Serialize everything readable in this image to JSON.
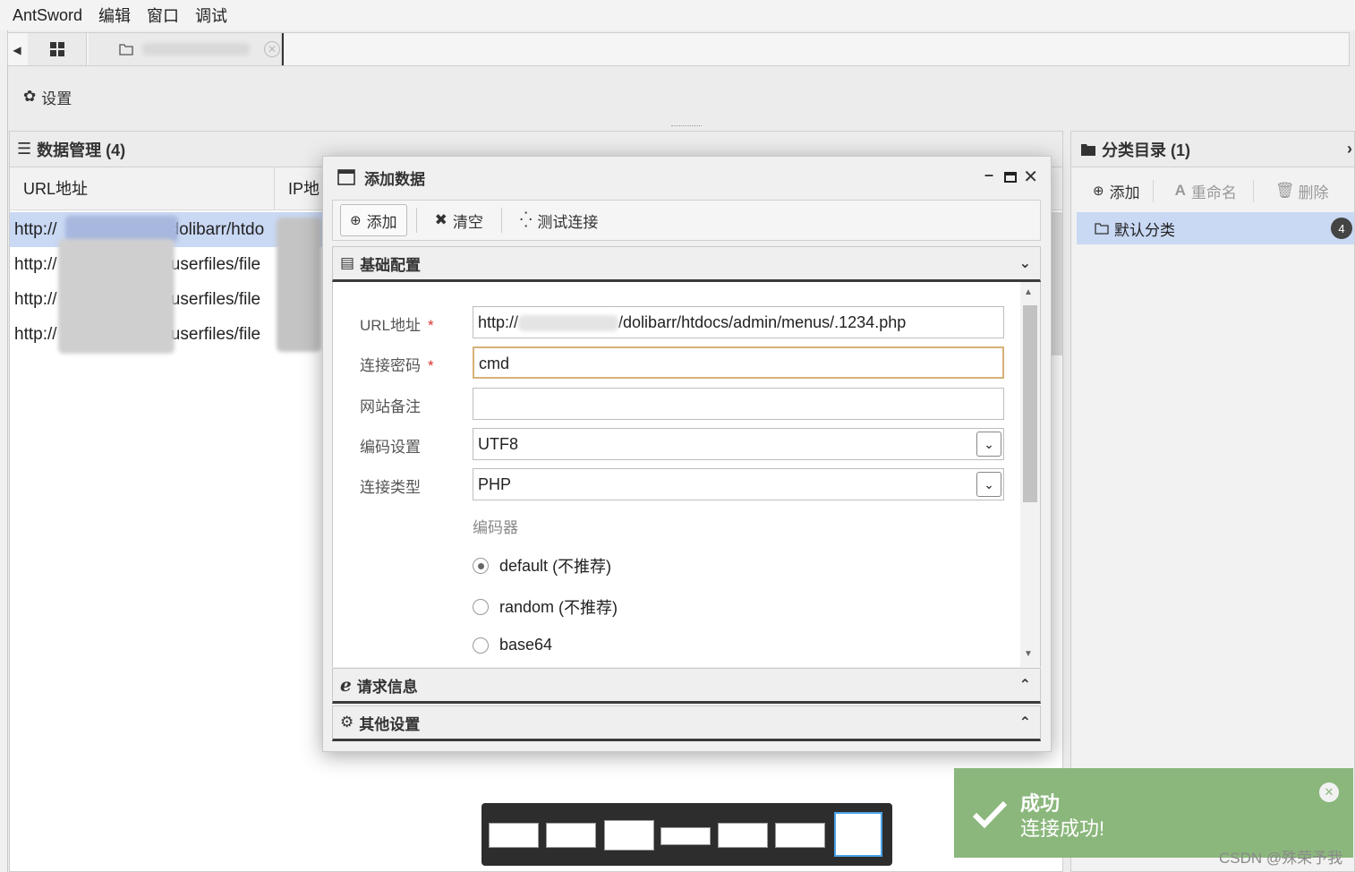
{
  "menubar": {
    "items": [
      "AntSword",
      "编辑",
      "窗口",
      "调试"
    ]
  },
  "settings": {
    "label": "设置"
  },
  "data_panel": {
    "title": "数据管理 (4)",
    "columns": [
      "URL地址",
      "IP地"
    ],
    "rows": [
      {
        "url_start": "http://",
        "url_end": "dolibarr/htdo"
      },
      {
        "url_start": "http://",
        "url_end": "/userfiles/file"
      },
      {
        "url_start": "http://",
        "url_end": "/userfiles/file"
      },
      {
        "url_start": "http://",
        "url_end": "/userfiles/file"
      }
    ]
  },
  "category_panel": {
    "title": "分类目录 (1)",
    "toolbar": {
      "add": "添加",
      "rename": "重命名",
      "delete": "删除"
    },
    "items": [
      {
        "label": "默认分类",
        "count": "4"
      }
    ]
  },
  "dialog": {
    "title": "添加数据",
    "toolbar": {
      "add": "添加",
      "clear": "清空",
      "test": "测试连接"
    },
    "sections": {
      "basic": "基础配置",
      "request": "请求信息",
      "other": "其他设置"
    },
    "form": {
      "url_label": "URL地址",
      "url_value_start": "http://",
      "url_value_end": "/dolibarr/htdocs/admin/menus/.1234.php",
      "password_label": "连接密码",
      "password_value": "cmd",
      "note_label": "网站备注",
      "note_value": "",
      "encoding_label": "编码设置",
      "encoding_value": "UTF8",
      "type_label": "连接类型",
      "type_value": "PHP",
      "encoder_label": "编码器",
      "required_mark": "*",
      "encoders": [
        {
          "label": "default",
          "note": "(不推荐)",
          "checked": true
        },
        {
          "label": "random",
          "note": "(不推荐)",
          "checked": false
        },
        {
          "label": "base64",
          "note": "",
          "checked": false
        }
      ]
    }
  },
  "toast": {
    "title": "成功",
    "message": "连接成功!"
  },
  "watermark": "CSDN @殊荣予我"
}
